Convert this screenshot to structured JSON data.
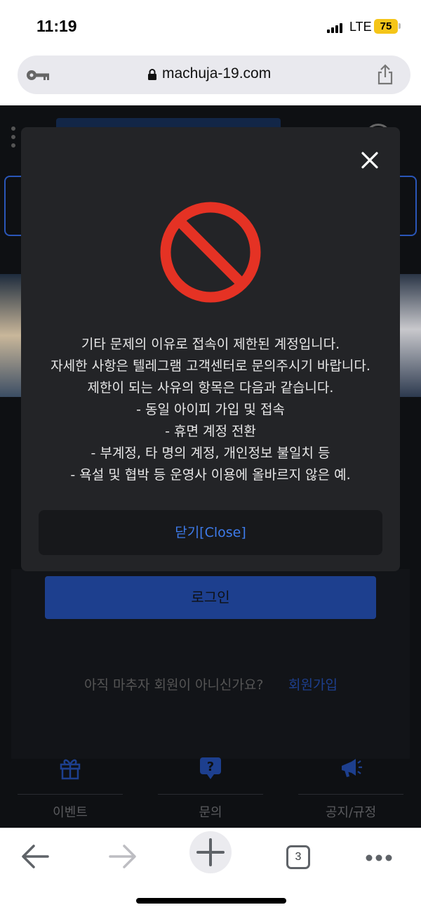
{
  "status_bar": {
    "time": "11:19",
    "network": "LTE",
    "battery": "75"
  },
  "browser": {
    "url": "machuja-19.com",
    "tab_count": "3"
  },
  "page": {
    "login_button": "로그인",
    "signup_prompt": "아직 마추자 회원이 아니신가요?",
    "signup_link": "회원가입",
    "bottom_nav": [
      {
        "label": "이벤트",
        "icon": "gift-icon"
      },
      {
        "label": "문의",
        "icon": "question-bubble-icon"
      },
      {
        "label": "공지/규정",
        "icon": "megaphone-icon"
      }
    ]
  },
  "modal": {
    "icon": "prohibited-icon",
    "lines": [
      "기타 문제의 이유로 접속이 제한된 계정입니다.",
      "자세한 사항은 텔레그램 고객센터로 문의주시기 바랍니다.",
      "제한이 되는 사유의 항목은 다음과 같습니다.",
      "- 동일 아이피 가입 및 접속",
      "- 휴면 계정 전환",
      "- 부계정, 타 명의 계정, 개인정보 불일치 등",
      "- 욕설 및 협박 등 운영사 이용에 올바르지 않은 예."
    ],
    "close_button": "닫기[Close]"
  },
  "colors": {
    "accent_blue": "#3e7bea",
    "modal_bg": "#232427",
    "page_bg": "#0e1013",
    "ban_red": "#e53224",
    "battery_yellow": "#f5c518"
  }
}
